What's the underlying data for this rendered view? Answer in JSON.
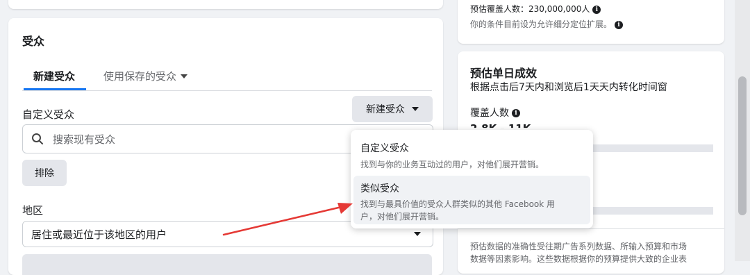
{
  "audience": {
    "title": "受众",
    "tabs": [
      {
        "label": "新建受众",
        "active": true
      },
      {
        "label": "使用保存的受众",
        "active": false
      }
    ],
    "custom_audience_label": "自定义受众",
    "new_audience_button": "新建受众",
    "search_placeholder": "搜索现有受众",
    "exclude_button": "排除",
    "location_label": "地区",
    "location_select_value": "居住或最近位于该地区的用户"
  },
  "dropdown": {
    "items": [
      {
        "title": "自定义受众",
        "desc": "找到与你的业务互动过的用户，对他们展开营销。"
      },
      {
        "title": "类似受众",
        "desc_line1": "找到与最具价值的受众人群类似的其他 Facebook 用",
        "desc_line2": "户，对他们展开营销。"
      }
    ]
  },
  "reach_card": {
    "estimated_reach_label": "预估覆盖人数：",
    "estimated_reach_value": "230,000,000人",
    "note": "你的条件目前设为允许细分定位扩展。"
  },
  "daily_results": {
    "title": "预估单日成效",
    "subtitle": "根据点击后7天内和浏览后1天天内转化时间窗",
    "reach_label": "覆盖人数",
    "reach_value": "2.8K - 11K",
    "footer_line1": "预估数据的准确性受往期广告系列数据、所输入预算和市场",
    "footer_line2": "数据等因素影响。这些数据根据你的预算提供大致的企业表"
  },
  "colors": {
    "accent": "#1877f2",
    "arrow": "#e53935",
    "page_bg": "#f0f2f5"
  }
}
